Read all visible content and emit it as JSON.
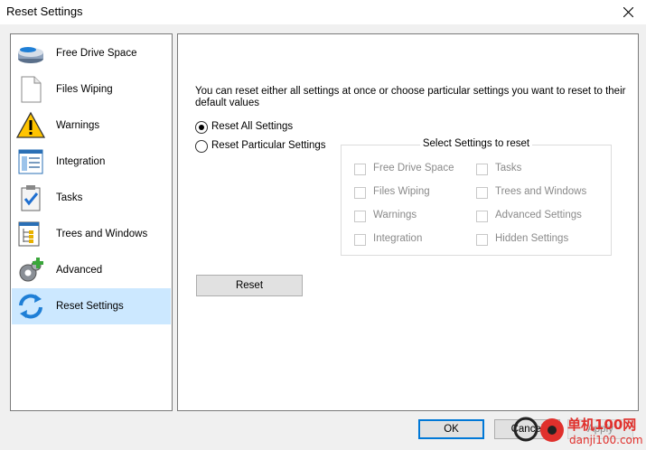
{
  "window": {
    "title": "Reset Settings"
  },
  "sidebar": {
    "items": [
      {
        "label": "Free Drive Space",
        "icon": "drive-icon"
      },
      {
        "label": "Files Wiping",
        "icon": "document-icon"
      },
      {
        "label": "Warnings",
        "icon": "warning-icon"
      },
      {
        "label": "Integration",
        "icon": "integration-icon"
      },
      {
        "label": "Tasks",
        "icon": "clipboard-check-icon"
      },
      {
        "label": "Trees and Windows",
        "icon": "tree-window-icon"
      },
      {
        "label": "Advanced",
        "icon": "gears-plus-icon"
      },
      {
        "label": "Reset Settings",
        "icon": "refresh-arrows-icon",
        "selected": true
      }
    ]
  },
  "main": {
    "description": "You can reset either all settings at once or choose particular settings you want to reset to their default values",
    "radio_all": "Reset All Settings",
    "radio_particular": "Reset Particular Settings",
    "selected_option": "Reset All Settings",
    "group_title": "Select Settings to reset",
    "checkboxes": [
      {
        "label": "Free Drive Space",
        "checked": false,
        "enabled": false
      },
      {
        "label": "Tasks",
        "checked": false,
        "enabled": false
      },
      {
        "label": "Files Wiping",
        "checked": false,
        "enabled": false
      },
      {
        "label": "Trees and Windows",
        "checked": false,
        "enabled": false
      },
      {
        "label": "Warnings",
        "checked": false,
        "enabled": false
      },
      {
        "label": "Advanced Settings",
        "checked": false,
        "enabled": false
      },
      {
        "label": "Integration",
        "checked": false,
        "enabled": false
      },
      {
        "label": "Hidden Settings",
        "checked": false,
        "enabled": false
      }
    ],
    "reset_button": "Reset"
  },
  "footer": {
    "ok": "OK",
    "cancel": "Cancel",
    "apply": "Apply"
  },
  "watermark": {
    "text": "单机100网",
    "url": "danji100.com"
  },
  "colors": {
    "selection": "#cce8ff",
    "accent": "#0078d7",
    "watermark": "#e0302c"
  }
}
